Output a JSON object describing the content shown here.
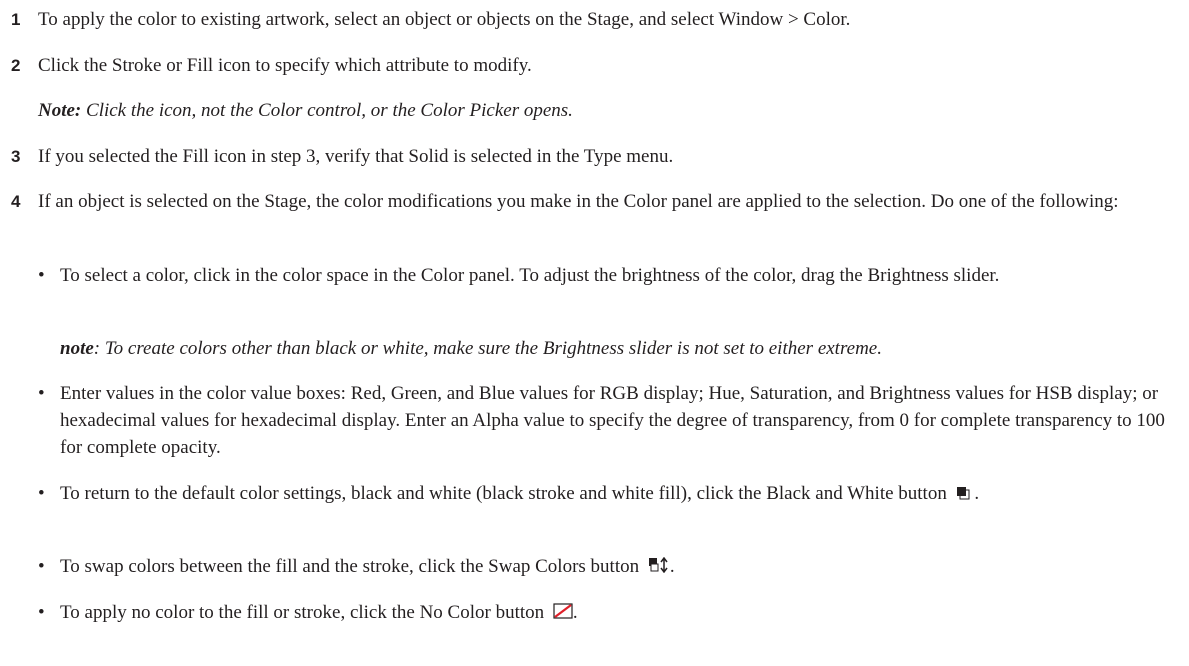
{
  "steps": [
    {
      "num": "1",
      "text": "To apply the color to existing artwork, select an object or objects on the Stage, and select Window > Color."
    },
    {
      "num": "2",
      "text": "Click the Stroke or Fill icon to specify which attribute to modify."
    },
    {
      "num": "3",
      "text": "If you selected the Fill icon in step 3, verify that Solid is selected in the Type menu."
    },
    {
      "num": "4",
      "text": "If an object is selected on the Stage, the color modifications you make in the Color panel are applied to the selection. Do one of the following:"
    }
  ],
  "note1": {
    "label": "Note:",
    "text": " Click the icon, not the Color control, or the Color Picker opens."
  },
  "bullets": [
    {
      "text": "To select a color, click in the color space in the Color panel. To adjust the brightness of the color, drag the Brightness slider."
    },
    {
      "text": "Enter values in the color value boxes: Red, Green, and Blue values for RGB display; Hue, Saturation, and Brightness values for HSB display; or hexadecimal values for hexadecimal display. Enter an Alpha value to specify the degree of transparency, from 0 for complete transparency to 100 for complete opacity."
    },
    {
      "text": "To return to the default color settings, black and white (black stroke and white fill), click the Black and White button",
      "after": " ."
    },
    {
      "text": "To swap colors between the fill and the stroke, click the Swap Colors button",
      "after": "."
    },
    {
      "text": "To apply no color to the fill or stroke, click the No Color button",
      "after": "."
    }
  ],
  "note2": {
    "label": "note",
    "text": ": To create colors other than black or white, make sure the Brightness slider is not set to either extreme."
  },
  "bullet_char": "•",
  "icons": {
    "bw": "black-and-white-icon",
    "swap": "swap-colors-icon",
    "nocolor": "no-color-icon",
    "nocolor_stroke": "#e0202a"
  }
}
